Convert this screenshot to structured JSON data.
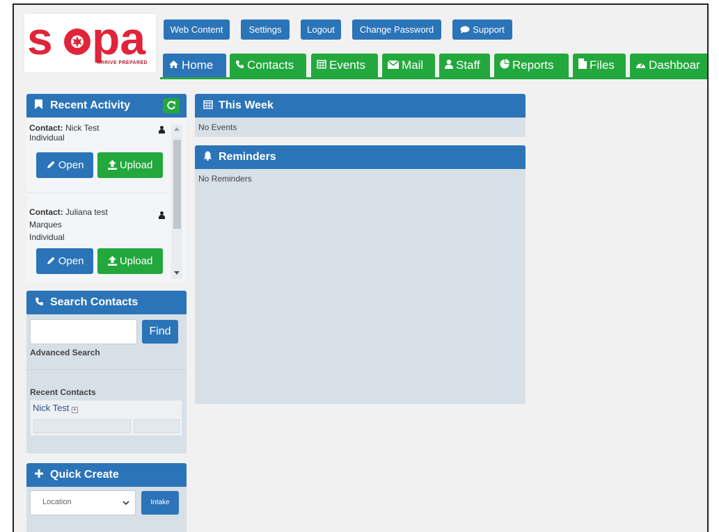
{
  "logo": {
    "wordmark": "sopa",
    "tagline": "ARRIVE PREPARED"
  },
  "top_buttons": {
    "web_content": "Web Content",
    "settings": "Settings",
    "logout": "Logout",
    "change_password": "Change Password",
    "support": "Support"
  },
  "nav_tabs": {
    "home": "Home",
    "contacts": "Contacts",
    "events": "Events",
    "mail": "Mail",
    "staff": "Staff",
    "reports": "Reports",
    "files": "Files",
    "dashboard": "Dashboar"
  },
  "recent_activity": {
    "title": "Recent Activity",
    "items": [
      {
        "label": "Contact:",
        "name": "Nick Test",
        "type": "Individual",
        "open": "Open",
        "upload": "Upload"
      },
      {
        "label": "Contact:",
        "name": "Juliana test",
        "name2": "Marques",
        "type": "Individual",
        "open": "Open",
        "upload": "Upload"
      }
    ]
  },
  "search_contacts": {
    "title": "Search Contacts",
    "search_value": "",
    "find": "Find",
    "advanced": "Advanced Search",
    "recent_title": "Recent Contacts",
    "recent_item": "Nick Test"
  },
  "quick_create": {
    "title": "Quick Create",
    "select_value": "Location",
    "intake": "Intake"
  },
  "this_week": {
    "title": "This Week",
    "empty": "No Events"
  },
  "reminders": {
    "title": "Reminders",
    "empty": "No Reminders"
  },
  "colors": {
    "blue": "#2b74b8",
    "green": "#23a83d",
    "panel_bg": "#d7dfe7",
    "logo_red": "#e0243a"
  }
}
